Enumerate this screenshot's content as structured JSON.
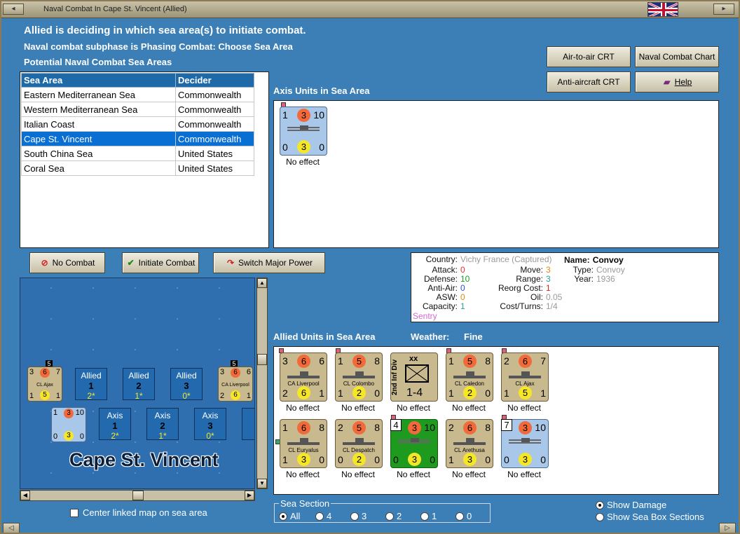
{
  "window": {
    "title": "Naval Combat In Cape St. Vincent (Allied)"
  },
  "header": {
    "line1": "Allied is deciding in which sea area(s) to initiate combat.",
    "line2": "Naval combat subphase is Phasing Combat: Choose Sea Area",
    "line3": "Potential Naval Combat Sea Areas"
  },
  "buttons": {
    "air_to_air": "Air-to-air CRT",
    "naval_chart": "Naval Combat Chart",
    "anti_aircraft": "Anti-aircraft CRT",
    "help": "Help",
    "no_combat": "No Combat",
    "initiate": "Initiate Combat",
    "switch": "Switch Major Power"
  },
  "sea_table": {
    "headers": [
      "Sea Area",
      "Decider"
    ],
    "rows": [
      [
        "Eastern Mediterranean Sea",
        "Commonwealth"
      ],
      [
        "Western Mediterranean Sea",
        "Commonwealth"
      ],
      [
        "Italian Coast",
        "Commonwealth"
      ],
      [
        "Cape St. Vincent",
        "Commonwealth"
      ],
      [
        "South China Sea",
        "United States"
      ],
      [
        "Coral Sea",
        "United States"
      ]
    ]
  },
  "axis": {
    "label": "Axis Units in Sea Area",
    "units": [
      {
        "tl": "1",
        "tm": "3",
        "tr": "10",
        "bl": "0",
        "bm": "3",
        "br": "0",
        "effect": "No effect"
      }
    ]
  },
  "info": {
    "country_k": "Country:",
    "country_v": "Vichy France (Captured)",
    "attack_k": "Attack:",
    "attack_v": "0",
    "defense_k": "Defense:",
    "defense_v": "10",
    "antiair_k": "Anti-Air:",
    "antiair_v": "0",
    "asw_k": "ASW:",
    "asw_v": "0",
    "capacity_k": "Capacity:",
    "capacity_v": "1",
    "sentry": "Sentry",
    "move_k": "Move:",
    "move_v": "3",
    "range_k": "Range:",
    "range_v": "3",
    "reorg_k": "Reorg Cost:",
    "reorg_v": "1",
    "oil_k": "Oil:",
    "oil_v": "0.05",
    "cost_k": "Cost/Turns:",
    "cost_v": "1/4",
    "name_k": "Name:",
    "name_v": "Convoy",
    "type_k": "Type:",
    "type_v": "Convoy",
    "year_k": "Year:",
    "year_v": "1936",
    "colors": {
      "attack": "#e8322a",
      "defense": "#1e9b1e",
      "antiair": "#2a4fd8",
      "asw": "#e08a12",
      "capacity": "#2aa0a0",
      "sentry": "#d26ad2",
      "gray": "#9a9a9a"
    }
  },
  "allied": {
    "label": "Allied Units in Sea Area",
    "weather_label": "Weather:",
    "weather": "Fine",
    "units": [
      {
        "tl": "3",
        "tm": "6",
        "tr": "6",
        "name": "CA Liverpool",
        "bl": "2",
        "bm": "6",
        "br": "1",
        "effect": "No effect"
      },
      {
        "tl": "1",
        "tm": "5",
        "tr": "8",
        "name": "CL Colombo",
        "bl": "1",
        "bm": "2",
        "br": "0",
        "effect": "No effect"
      },
      {
        "div_label": "2nd Inf Div",
        "xx": "xx",
        "strength": "1-4",
        "effect": "No effect"
      },
      {
        "tl": "1",
        "tm": "5",
        "tr": "8",
        "name": "CL Caledon",
        "bl": "1",
        "bm": "2",
        "br": "0",
        "effect": "No effect"
      },
      {
        "tl": "2",
        "tm": "6",
        "tr": "7",
        "name": "CL Ajax",
        "bl": "1",
        "bm": "5",
        "br": "1",
        "effect": "No effect"
      },
      {
        "tl": "1",
        "tm": "6",
        "tr": "8",
        "name": "CL Euryalus",
        "bl": "1",
        "bm": "3",
        "br": "0",
        "effect": "No effect"
      },
      {
        "tl": "2",
        "tm": "5",
        "tr": "8",
        "name": "CL Despatch",
        "bl": "0",
        "bm": "2",
        "br": "0",
        "effect": "No effect"
      },
      {
        "tl": "4",
        "tm": "3",
        "tr": "10",
        "bl": "0",
        "bm": "3",
        "br": "0",
        "effect": "No effect"
      },
      {
        "tl": "2",
        "tm": "6",
        "tr": "8",
        "name": "CL Arethusa",
        "bl": "1",
        "bm": "3",
        "br": "0",
        "effect": "No effect"
      },
      {
        "tl": "7",
        "tm": "3",
        "tr": "10",
        "bl": "0",
        "bm": "3",
        "br": "0",
        "effect": "No effect"
      }
    ]
  },
  "map": {
    "title": "Cape St. Vincent",
    "left_counter": {
      "top": "5",
      "tl": "3",
      "tm": "6",
      "tr": "7",
      "name": "CL Ajax",
      "bl": "1",
      "bm": "5",
      "br": "1"
    },
    "right_counter": {
      "top": "5",
      "tl": "3",
      "tm": "6",
      "tr": "6",
      "name": "CA Liverpool",
      "bl": "2",
      "bm": "6",
      "br": "1"
    },
    "blue_counter": {
      "tl": "1",
      "tm": "3",
      "tr": "10",
      "bl": "0",
      "bm": "3",
      "br": "0"
    },
    "allied_boxes": [
      {
        "side": "Allied",
        "num": "1",
        "val": "2*"
      },
      {
        "side": "Allied",
        "num": "2",
        "val": "1*"
      },
      {
        "side": "Allied",
        "num": "3",
        "val": "0*"
      }
    ],
    "axis_boxes": [
      {
        "side": "Axis",
        "num": "1",
        "val": "2*"
      },
      {
        "side": "Axis",
        "num": "2",
        "val": "1*"
      },
      {
        "side": "Axis",
        "num": "3",
        "val": "0*"
      },
      {
        "side": "A"
      }
    ]
  },
  "bottom": {
    "center_linked": "Center linked map on sea area",
    "sea_section": "Sea Section",
    "sections": [
      "All",
      "4",
      "3",
      "2",
      "1",
      "0"
    ],
    "show_damage": "Show Damage",
    "show_sea_box": "Show Sea Box Sections"
  }
}
